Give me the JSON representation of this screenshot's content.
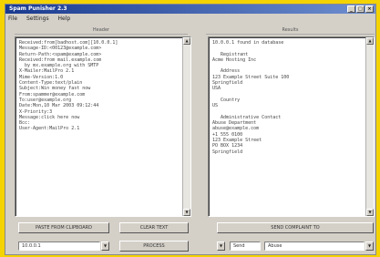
{
  "window": {
    "title": "Spam Punisher 2.3"
  },
  "menu": [
    "File",
    "Settings",
    "Help"
  ],
  "headers": {
    "left": "Header",
    "right": "Results"
  },
  "left_text": "Received:from[badhost.com][10.0.0.1]\nMessage-ID:<00123@example.com>\nReturn-Path:<spam@example.com>\nReceived:from mail.example.com\n  by mx.example.org with SMTP\nX-Mailer:MailPro 2.1\nMime-Version:1.0\nContent-Type:text/plain\nSubject:Win money fast now\nFrom:spammer@example.com\nTo:user@example.org\nDate:Mon,10 Mar 2003 09:12:44\nX-Priority:3\nMessage:click here now\nBcc:\nUser-Agent:MailPro 2.1",
  "right_text": "10.0.0.1 found in database\n\n   Registrant\nAcme Hosting Inc\n\n   Address\n123 Example Street Suite 100\nSpringfield\nUSA\n\n   Country\nUS\n\n   Administrative Contact\nAbuse Department\nabuse@example.com\n+1 555 0100\n123 Example Street\nPO BOX 1234\nSpringfield",
  "buttons": {
    "paste": "PASTE FROM CLIPBOARD",
    "clear": "CLEAR TEXT",
    "process": "PROCESS",
    "complaint": "SEND COMPLAINT TO"
  },
  "fields": {
    "ip": "10.0.0.1",
    "send_from": "Send",
    "send_to": "Abuse"
  }
}
